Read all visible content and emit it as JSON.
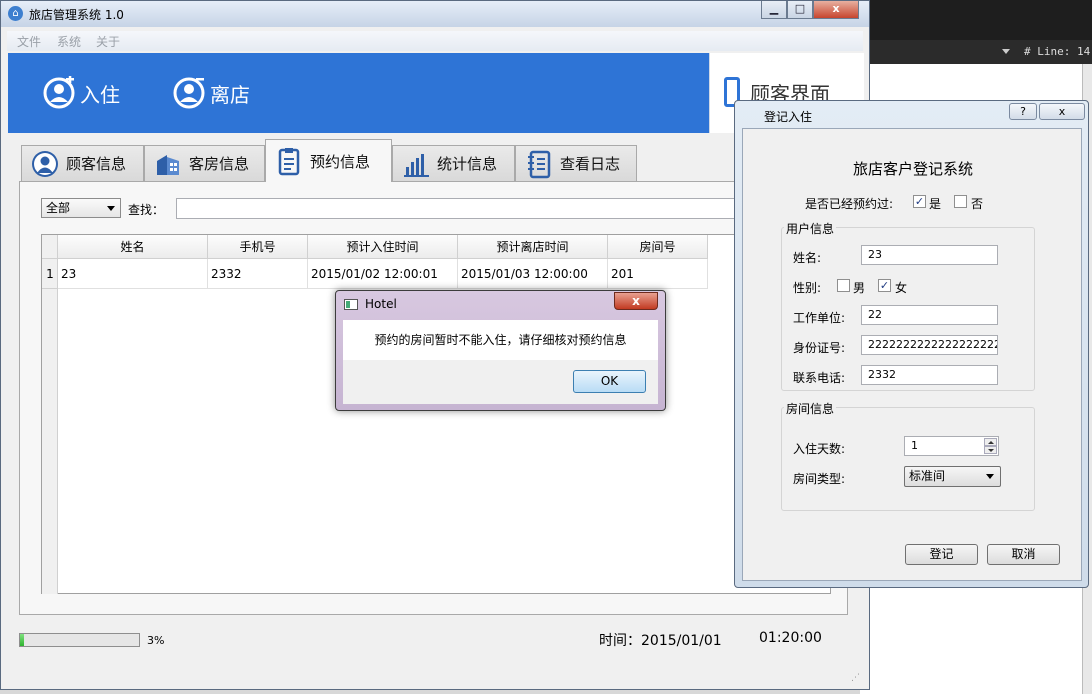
{
  "background_editor": {
    "status_text": "# Line: 14"
  },
  "main_window": {
    "title": "旅店管理系统 1.0",
    "controls": {
      "minimize": "▁",
      "maximize": "□",
      "close": "x"
    },
    "menu": [
      "文件",
      "系统",
      "关于"
    ],
    "banner": {
      "checkin_label": "入住",
      "checkout_label": "离店",
      "customer_ui_label": "顾客界面"
    },
    "tabs": [
      {
        "label": "顾客信息",
        "icon": "user-circle-icon"
      },
      {
        "label": "客房信息",
        "icon": "building-icon"
      },
      {
        "label": "预约信息",
        "icon": "clipboard-icon",
        "active": true
      },
      {
        "label": "统计信息",
        "icon": "bar-chart-icon"
      },
      {
        "label": "查看日志",
        "icon": "notebook-icon"
      }
    ],
    "filter": {
      "selected": "全部",
      "search_label": "查找：",
      "search_value": ""
    },
    "table": {
      "columns": [
        "姓名",
        "手机号",
        "预计入住时间",
        "预计离店时间",
        "房间号"
      ],
      "rows": [
        {
          "index": "1",
          "cells": [
            "23",
            "2332",
            "2015/01/02 12:00:01",
            "2015/01/03 12:00:00",
            "201"
          ]
        }
      ]
    },
    "status": {
      "progress_percent": 3,
      "progress_text": "3%",
      "time_label": "时间：2015/01/01",
      "clock": "01:20:00"
    }
  },
  "message_box": {
    "title": "Hotel",
    "close": "x",
    "message": "预约的房间暂时不能入住，请仔细核对预约信息",
    "ok_label": "OK"
  },
  "register_dialog": {
    "title": "登记入住",
    "help": "?",
    "close": "x",
    "heading": "旅店客户登记系统",
    "reserved_question": "是否已经预约过:",
    "yes_label": "是",
    "no_label": "否",
    "yes_checked": true,
    "no_checked": false,
    "user_group_title": "用户信息",
    "name_label": "姓名:",
    "name_value": "23",
    "gender_label": "性别:",
    "male_label": "男",
    "female_label": "女",
    "male_checked": false,
    "female_checked": true,
    "company_label": "工作单位:",
    "company_value": "22",
    "id_label": "身份证号:",
    "id_value": "2222222222222222222",
    "phone_label": "联系电话:",
    "phone_value": "2332",
    "room_group_title": "房间信息",
    "days_label": "入住天数:",
    "days_value": "1",
    "room_type_label": "房间类型:",
    "room_type_value": "标准间",
    "register_button": "登记",
    "cancel_button": "取消"
  },
  "colors": {
    "banner_blue": "#2e74d6",
    "progress_green": "#2fb32f",
    "close_red": "#c7452e"
  }
}
